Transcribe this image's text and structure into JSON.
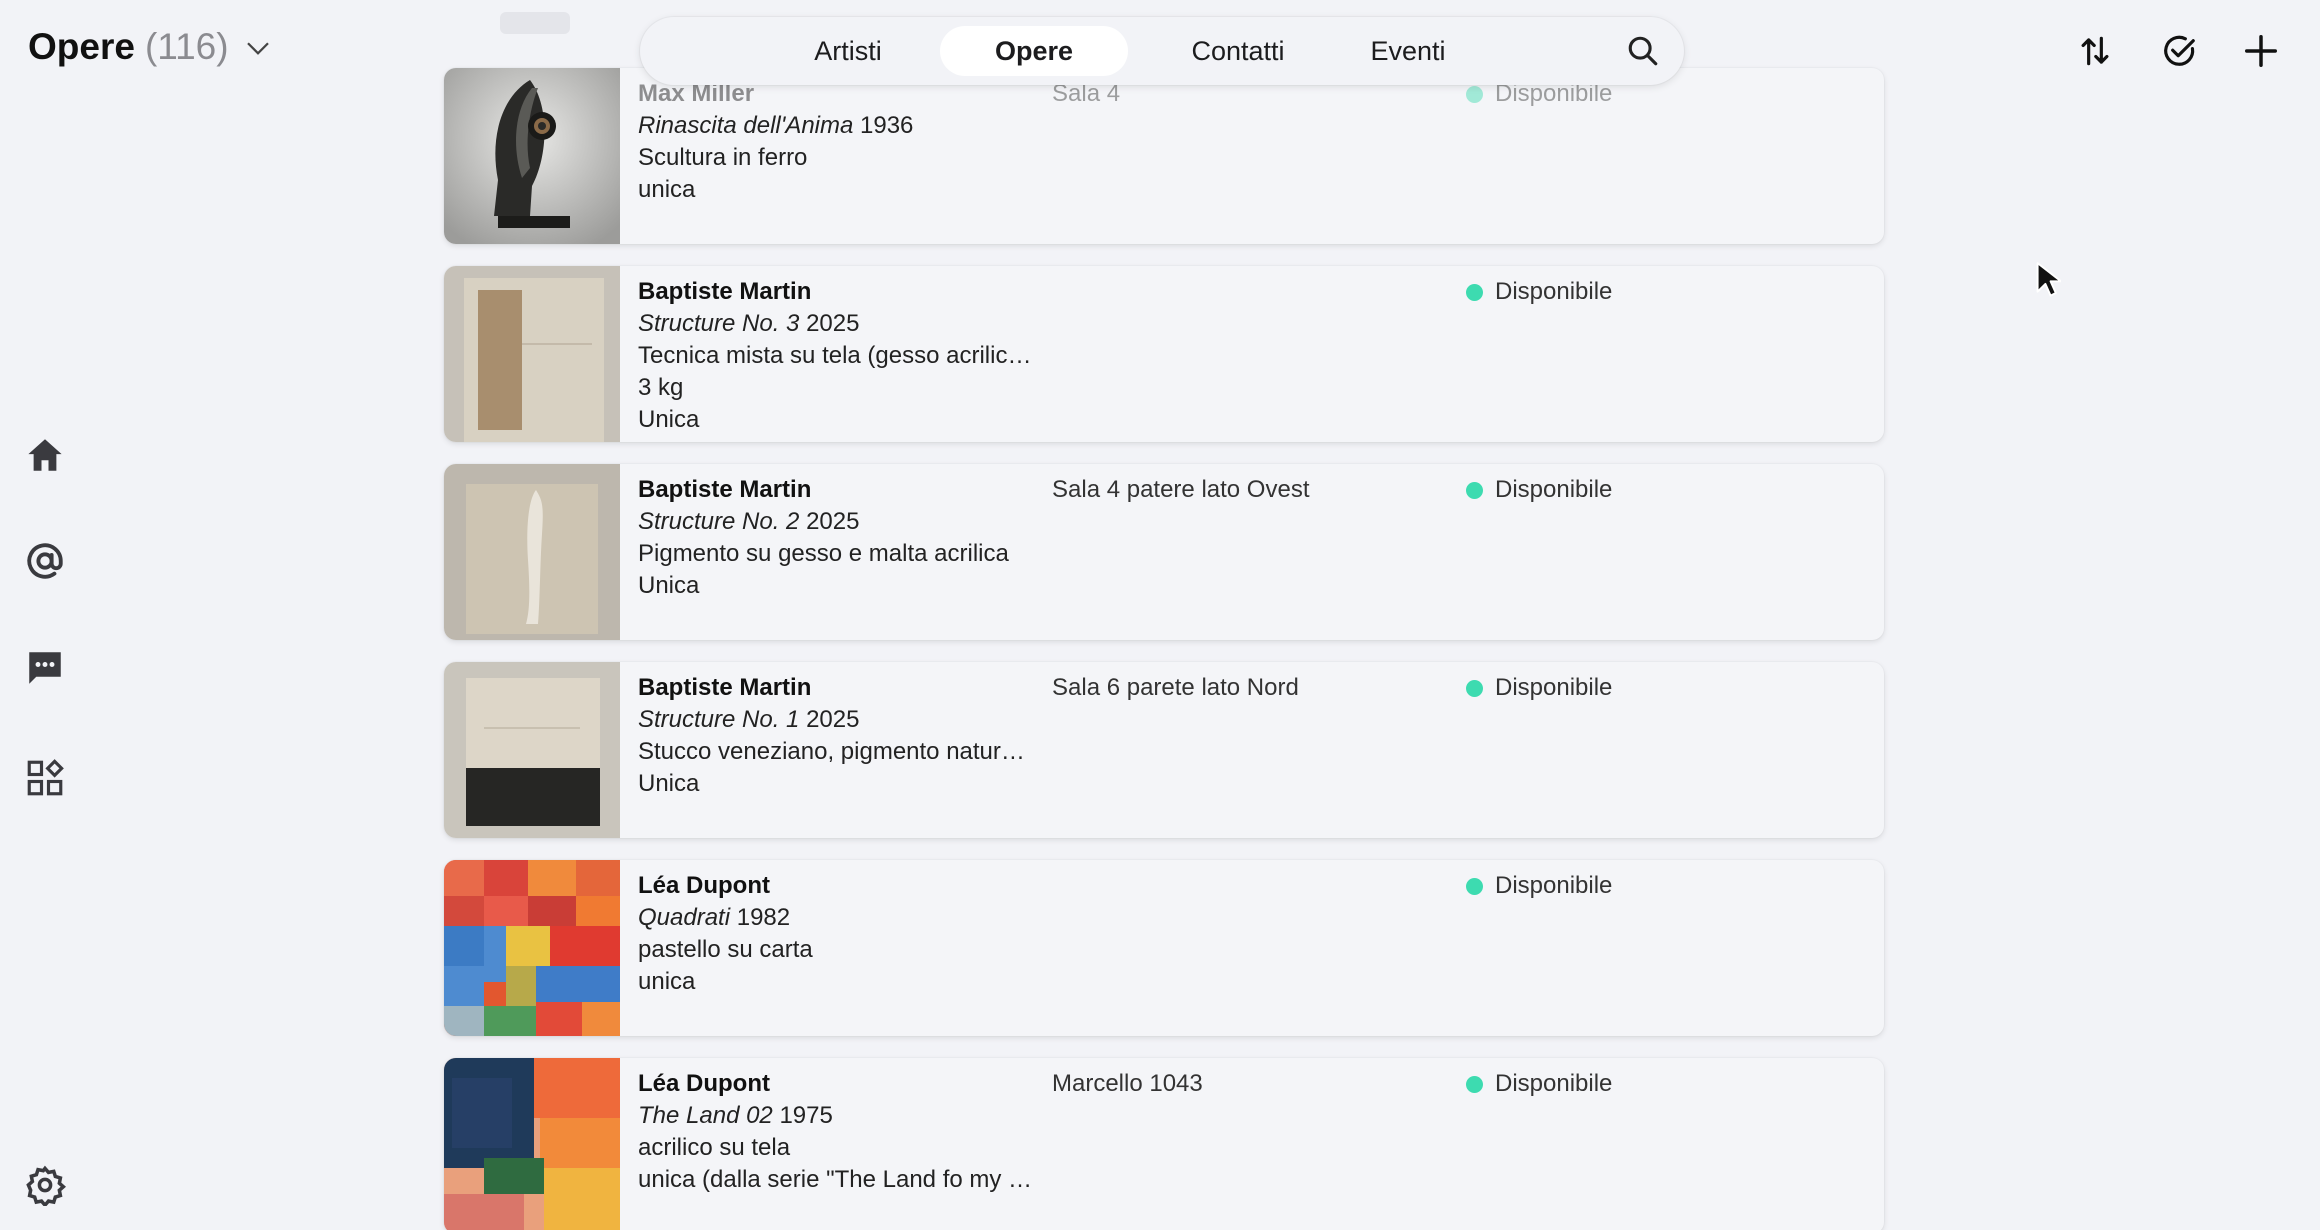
{
  "header": {
    "title": "Opere",
    "count": "(116)"
  },
  "nav": {
    "tabs": [
      {
        "label": "Artisti",
        "active": false
      },
      {
        "label": "Opere",
        "active": true
      },
      {
        "label": "Contatti",
        "active": false
      },
      {
        "label": "Eventi",
        "active": false
      }
    ],
    "search_icon": "search-icon"
  },
  "actions": [
    "sort-icon",
    "check-circle-icon",
    "plus-icon"
  ],
  "sidebar": [
    "home-icon",
    "at-sign-icon",
    "chat-icon",
    "widgets-icon",
    "settings-icon"
  ],
  "colors": {
    "background": "#f2f3f7",
    "status_dot": "#3ddbb0",
    "active_tab": "#ffffff"
  },
  "works": [
    {
      "artist": "Max Miller",
      "title": "Rinascita dell'Anima",
      "year": "1936",
      "technique": "Scultura in ferro",
      "weight": "",
      "edition": "unica",
      "location": "Sala 4",
      "status": "Disponibile"
    },
    {
      "artist": "Baptiste Martin",
      "title": "Structure No. 3",
      "year": "2025",
      "technique": "Tecnica mista su tela (gesso acrilico, …",
      "weight": "3 kg",
      "edition": "Unica",
      "location": "",
      "status": "Disponibile"
    },
    {
      "artist": "Baptiste Martin",
      "title": "Structure No. 2",
      "year": "2025",
      "technique": "Pigmento su gesso e malta acrilica",
      "weight": "",
      "edition": "Unica",
      "location": "Sala 4 patere lato Ovest",
      "status": "Disponibile"
    },
    {
      "artist": "Baptiste Martin",
      "title": "Structure No. 1",
      "year": "2025",
      "technique": "Stucco veneziano, pigmento natural…",
      "weight": "",
      "edition": "Unica",
      "location": "Sala 6 parete lato Nord",
      "status": "Disponibile"
    },
    {
      "artist": "Léa Dupont",
      "title": "Quadrati",
      "year": "1982",
      "technique": "pastello su carta",
      "weight": "",
      "edition": "unica",
      "location": "",
      "status": "Disponibile"
    },
    {
      "artist": "Léa Dupont",
      "title": "The Land 02",
      "year": "1975",
      "technique": "acrilico su tela",
      "weight": "",
      "edition": "unica (dalla serie \"The Land fo my Li…",
      "location": "Marcello 1043",
      "status": "Disponibile"
    }
  ]
}
